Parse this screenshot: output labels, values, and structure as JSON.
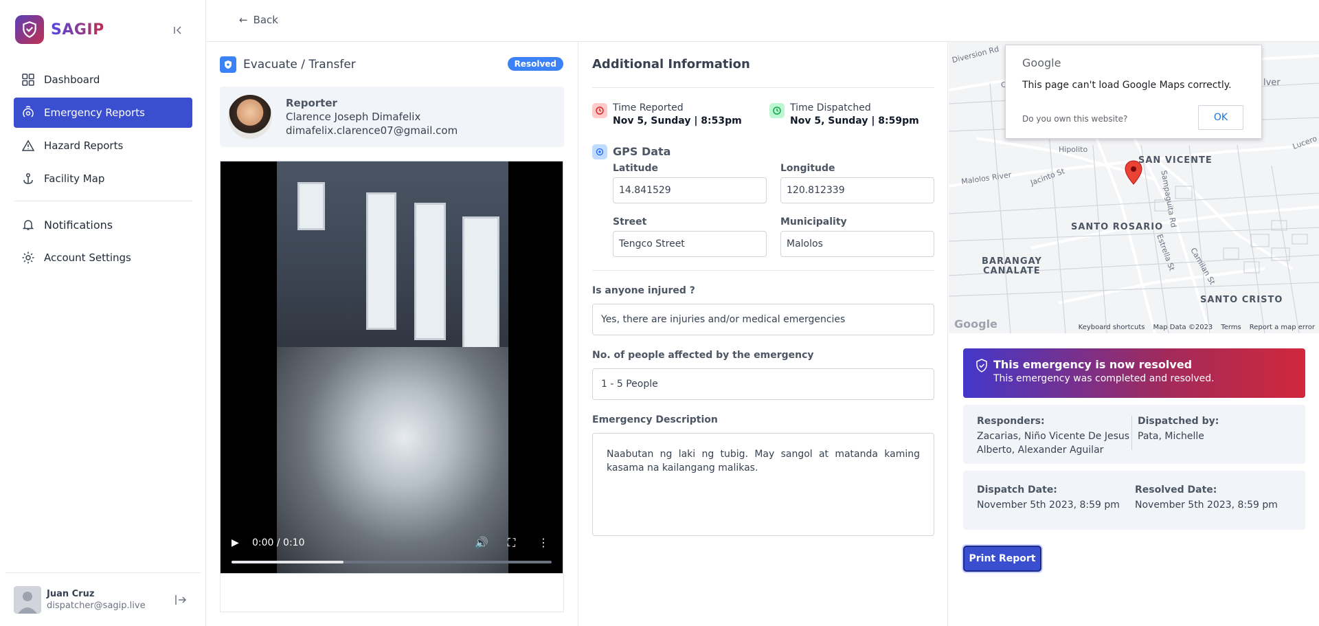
{
  "brand": {
    "name": "SAGIP"
  },
  "sidebar": {
    "items": [
      {
        "label": "Dashboard",
        "icon": "grid-icon"
      },
      {
        "label": "Emergency Reports",
        "icon": "location-signal-icon"
      },
      {
        "label": "Hazard Reports",
        "icon": "warning-icon"
      },
      {
        "label": "Facility Map",
        "icon": "anchor-icon"
      },
      {
        "label": "Notifications",
        "icon": "bell-icon"
      },
      {
        "label": "Account Settings",
        "icon": "gear-icon"
      }
    ],
    "user": {
      "name": "Juan Cruz",
      "email": "dispatcher@sagip.live"
    }
  },
  "topbar": {
    "back_label": "Back"
  },
  "report": {
    "type": "Evacuate / Transfer",
    "status": "Resolved",
    "reporter_title": "Reporter",
    "reporter_name": "Clarence Joseph Dimafelix",
    "reporter_email": "dimafelix.clarence07@gmail.com",
    "video": {
      "time": "0:00 / 0:10",
      "progress": 0.35
    }
  },
  "info": {
    "title": "Additional Information",
    "time_reported_label": "Time Reported",
    "time_reported": "Nov 5, Sunday | 8:53pm",
    "time_dispatched_label": "Time Dispatched",
    "time_dispatched": "Nov 5, Sunday | 8:59pm",
    "gps_title": "GPS Data",
    "latitude_label": "Latitude",
    "latitude": "14.841529",
    "longitude_label": "Longitude",
    "longitude": "120.812339",
    "street_label": "Street",
    "street": "Tengco Street",
    "municipality_label": "Municipality",
    "municipality": "Malolos",
    "injured_label": "Is anyone injured ?",
    "injured": "Yes, there are injuries and/or medical emergencies",
    "affected_label": "No. of people affected by the emergency",
    "affected": "1 - 5 People",
    "description_label": "Emergency Description",
    "description": "Naabutan ng laki ng tubig. May sangol at matanda kaming kasama na kailangang malikas."
  },
  "map": {
    "google": "Google",
    "error": "This page can't load Google Maps correctly.",
    "own": "Do you own this website?",
    "ok": "OK",
    "labels": [
      "SAN VICENTE",
      "SANTO ROSARIO",
      "BARANGAY",
      "CANALATE",
      "SANTO CRISTO"
    ],
    "rivers": [
      "Malolos River",
      "Diversion Rd",
      "Jacinto St",
      "Hipolito",
      "Lucero",
      "Estrella St",
      "Camilan St",
      "Sampaguita Rd"
    ],
    "footer": [
      "Keyboard shortcuts",
      "Map Data ©2023",
      "Terms",
      "Report a map error"
    ],
    "watermark": "Google",
    "edge_labels": [
      "C",
      "lver"
    ]
  },
  "resolution": {
    "title": "This emergency is now resolved",
    "subtitle": "This emergency was completed and resolved.",
    "responders_label": "Responders:",
    "responders": [
      "Zacarias, Niño Vicente De Jesus",
      "Alberto, Alexander Aguilar"
    ],
    "dispatched_by_label": "Dispatched by:",
    "dispatched_by": "Pata, Michelle",
    "dispatch_date_label": "Dispatch Date:",
    "dispatch_date": "November 5th 2023, 8:59 pm",
    "resolved_date_label": "Resolved Date:",
    "resolved_date": "November 5th 2023, 8:59 pm",
    "print_label": "Print Report"
  },
  "colors": {
    "accent": "#3a4fd0",
    "badge": "#3b82f6",
    "banner_start": "#4338ca",
    "banner_end": "#d1283b"
  }
}
